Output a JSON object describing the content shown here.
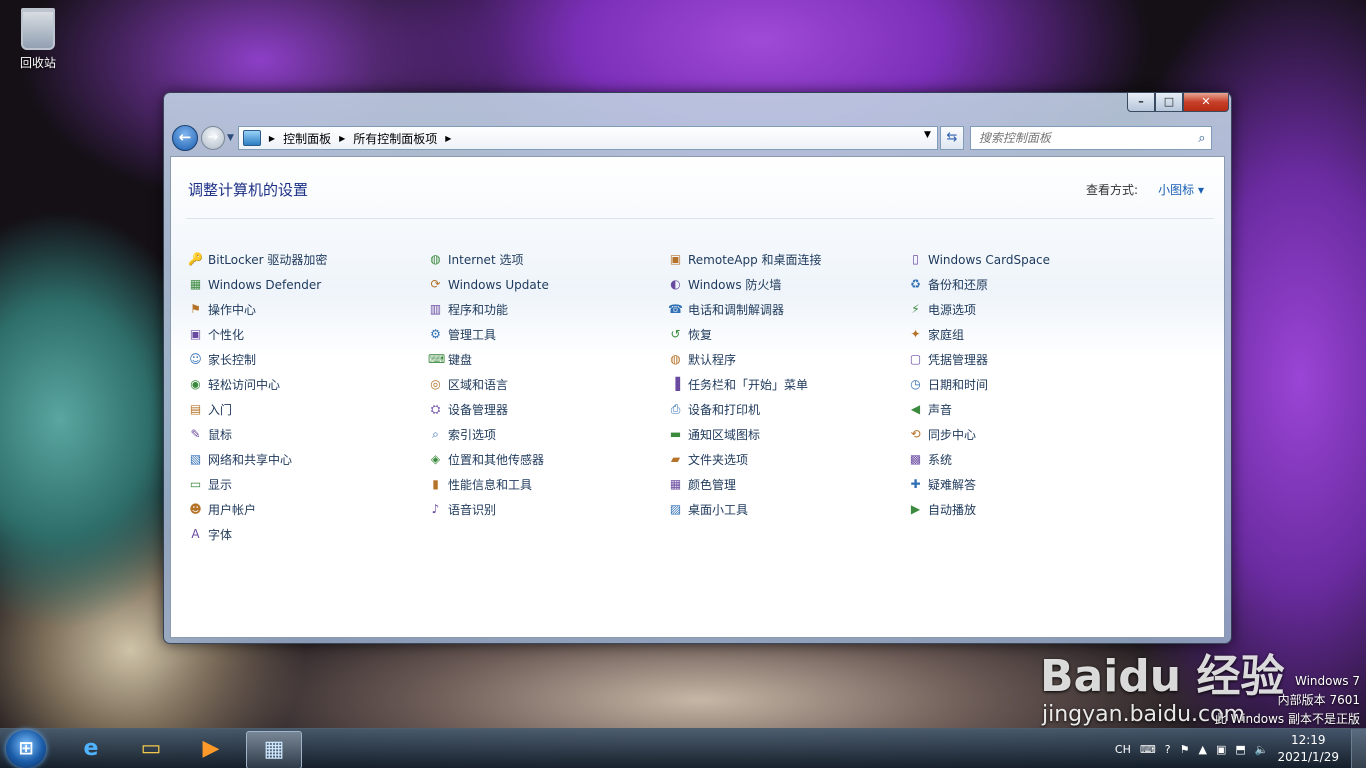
{
  "desktop": {
    "recycle_bin": "回收站"
  },
  "window": {
    "breadcrumb": [
      "控制面板",
      "所有控制面板项"
    ],
    "search_placeholder": "搜索控制面板",
    "title": "调整计算机的设置",
    "view_by_label": "查看方式:",
    "view_by_value": "小图标 ▾",
    "columns": [
      [
        {
          "label": "BitLocker 驱动器加密",
          "icon": "bitlocker-icon"
        },
        {
          "label": "Windows Defender",
          "icon": "defender-icon"
        },
        {
          "label": "操作中心",
          "icon": "flag-icon"
        },
        {
          "label": "个性化",
          "icon": "personalization-icon"
        },
        {
          "label": "家长控制",
          "icon": "parental-controls-icon"
        },
        {
          "label": "轻松访问中心",
          "icon": "ease-of-access-icon"
        },
        {
          "label": "入门",
          "icon": "getting-started-icon"
        },
        {
          "label": "鼠标",
          "icon": "mouse-icon"
        },
        {
          "label": "网络和共享中心",
          "icon": "network-icon"
        },
        {
          "label": "显示",
          "icon": "display-icon"
        },
        {
          "label": "用户帐户",
          "icon": "user-accounts-icon"
        },
        {
          "label": "字体",
          "icon": "fonts-icon"
        }
      ],
      [
        {
          "label": "Internet 选项",
          "icon": "internet-options-icon"
        },
        {
          "label": "Windows Update",
          "icon": "windows-update-icon"
        },
        {
          "label": "程序和功能",
          "icon": "programs-icon"
        },
        {
          "label": "管理工具",
          "icon": "admin-tools-icon"
        },
        {
          "label": "键盘",
          "icon": "keyboard-icon"
        },
        {
          "label": "区域和语言",
          "icon": "region-language-icon"
        },
        {
          "label": "设备管理器",
          "icon": "device-manager-icon"
        },
        {
          "label": "索引选项",
          "icon": "indexing-icon"
        },
        {
          "label": "位置和其他传感器",
          "icon": "sensors-icon"
        },
        {
          "label": "性能信息和工具",
          "icon": "performance-icon"
        },
        {
          "label": "语音识别",
          "icon": "microphone-icon"
        }
      ],
      [
        {
          "label": "RemoteApp 和桌面连接",
          "icon": "remoteapp-icon"
        },
        {
          "label": "Windows 防火墙",
          "icon": "firewall-icon"
        },
        {
          "label": "电话和调制解调器",
          "icon": "phone-modem-icon"
        },
        {
          "label": "恢复",
          "icon": "recovery-icon"
        },
        {
          "label": "默认程序",
          "icon": "default-programs-icon"
        },
        {
          "label": "任务栏和「开始」菜单",
          "icon": "taskbar-icon"
        },
        {
          "label": "设备和打印机",
          "icon": "printer-icon"
        },
        {
          "label": "通知区域图标",
          "icon": "notification-icon"
        },
        {
          "label": "文件夹选项",
          "icon": "folder-options-icon"
        },
        {
          "label": "颜色管理",
          "icon": "color-management-icon"
        },
        {
          "label": "桌面小工具",
          "icon": "gadgets-icon"
        }
      ],
      [
        {
          "label": "Windows CardSpace",
          "icon": "cardspace-icon"
        },
        {
          "label": "备份和还原",
          "icon": "backup-icon"
        },
        {
          "label": "电源选项",
          "icon": "power-icon"
        },
        {
          "label": "家庭组",
          "icon": "homegroup-icon"
        },
        {
          "label": "凭据管理器",
          "icon": "credential-icon"
        },
        {
          "label": "日期和时间",
          "icon": "calendar-icon"
        },
        {
          "label": "声音",
          "icon": "speaker-icon"
        },
        {
          "label": "同步中心",
          "icon": "sync-icon"
        },
        {
          "label": "系统",
          "icon": "system-icon"
        },
        {
          "label": "疑难解答",
          "icon": "troubleshooting-icon"
        },
        {
          "label": "自动播放",
          "icon": "autoplay-icon"
        }
      ]
    ]
  },
  "watermark": {
    "line1": "Windows 7",
    "line2": "内部版本 7601",
    "line3": "此 Windows 副本不是正版"
  },
  "baidu": {
    "logo": "Baidu 经验",
    "url": "jingyan.baidu.com"
  },
  "taskbar": {
    "ime": "CH",
    "time": "12:19",
    "date": "2021/1/29"
  }
}
